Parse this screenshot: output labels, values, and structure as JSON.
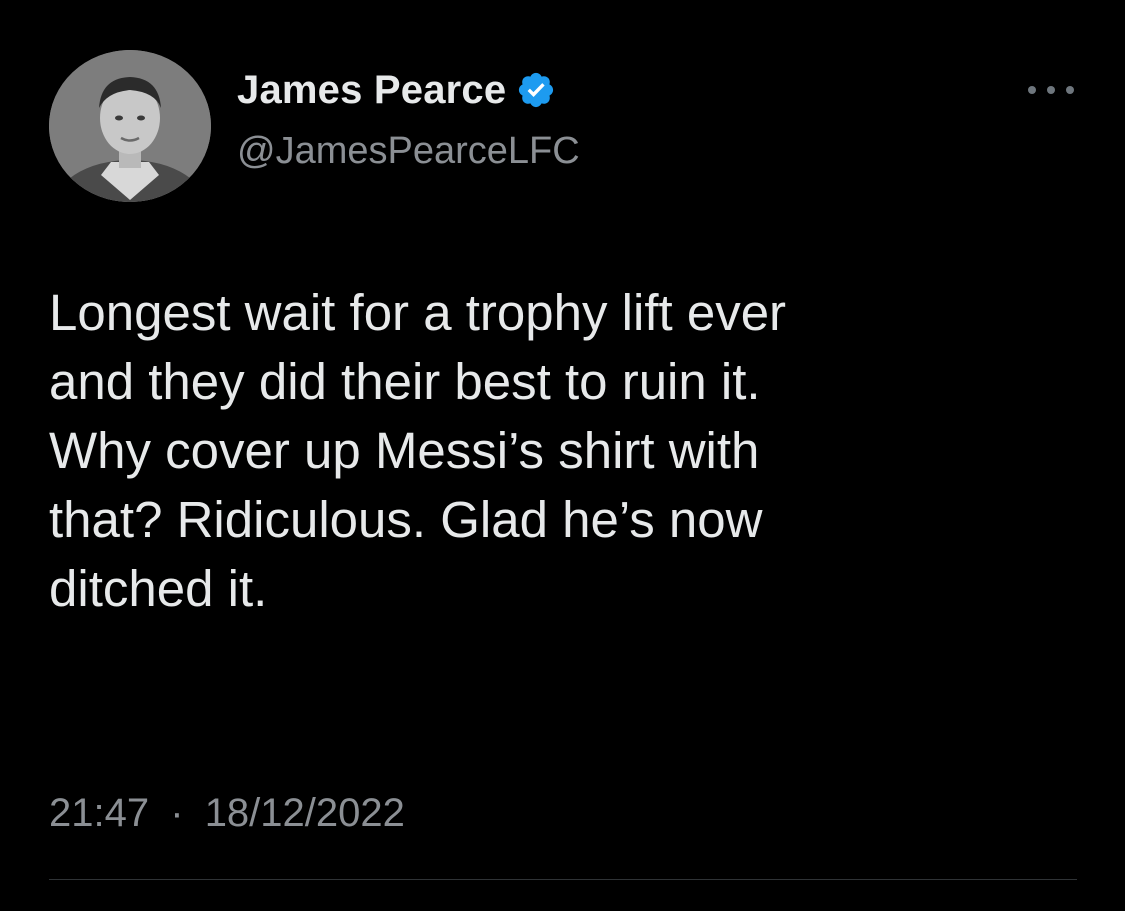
{
  "user": {
    "display_name": "James Pearce",
    "handle": "@JamesPearceLFC",
    "verified": true,
    "avatar_icon": "profile-photo"
  },
  "tweet": {
    "text": "Longest wait for a trophy lift ever\nand they did their best to ruin it.\nWhy cover up Messi’s shirt with\nthat? Ridiculous. Glad he’s now\nditched it.",
    "time": "21:47",
    "separator": "·",
    "date": "18/12/2022"
  },
  "icons": {
    "verified": "verified-badge-icon",
    "more": "more-options-icon"
  },
  "colors": {
    "background": "#000000",
    "primary_text": "#e7e9ea",
    "secondary_text": "#8b8f94",
    "verified_blue": "#1d9bf0",
    "divider": "#2f3336"
  }
}
